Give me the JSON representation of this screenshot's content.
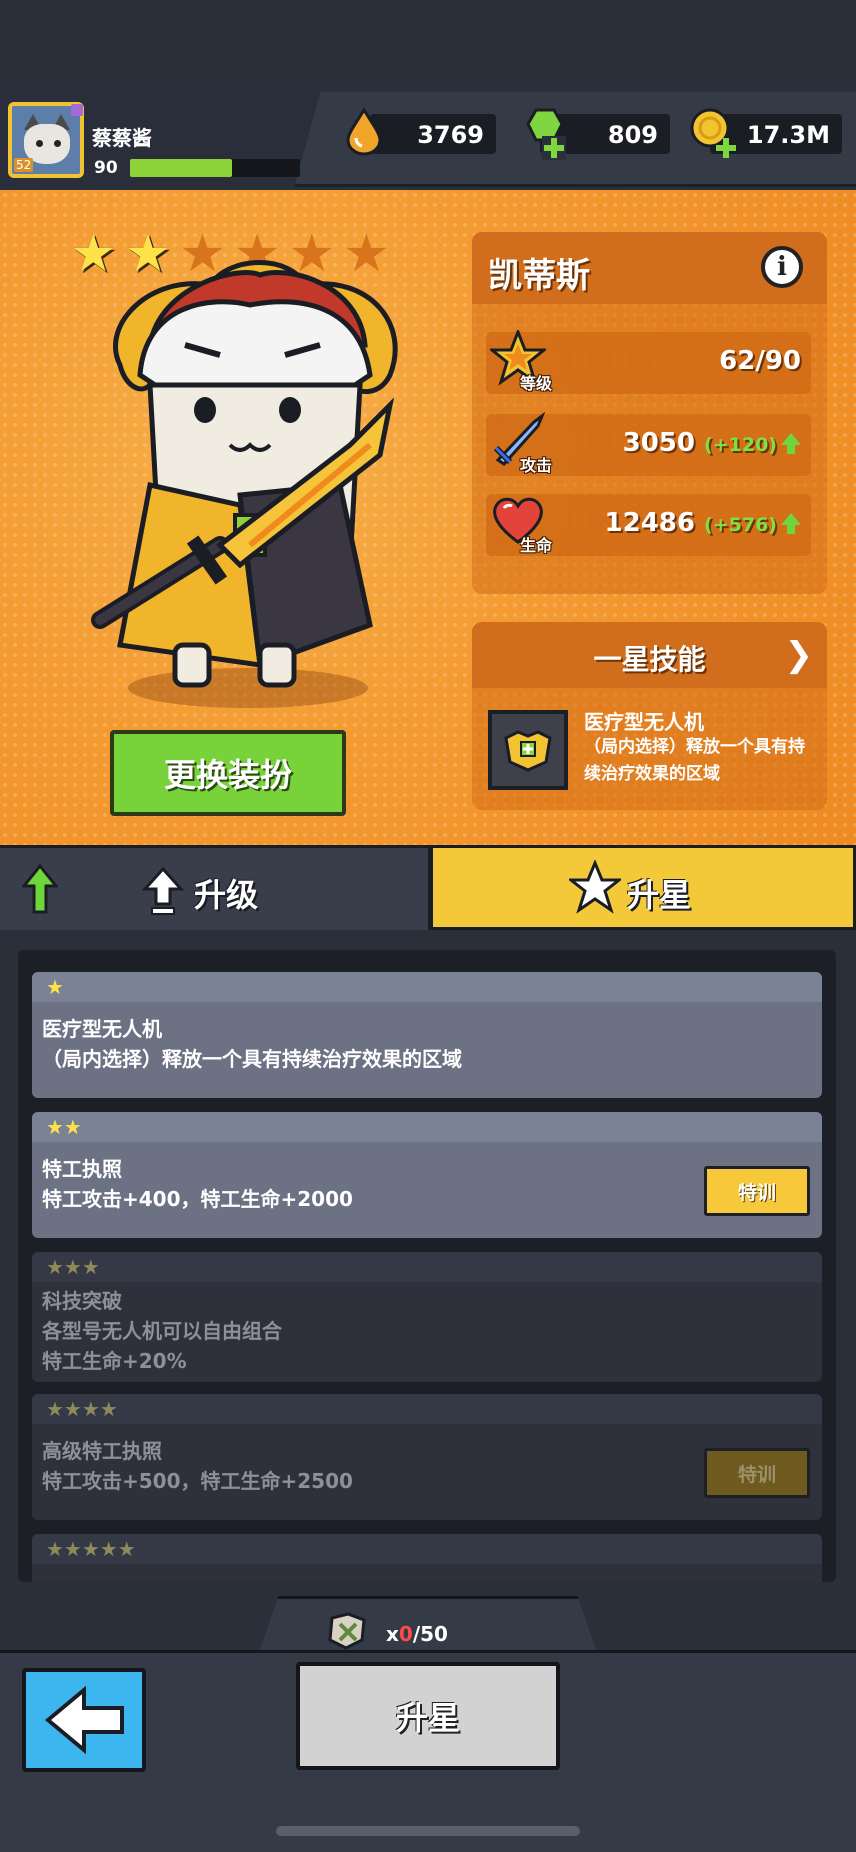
{
  "player": {
    "name": "蔡蔡酱",
    "level": "90",
    "avatar_tag": "52",
    "xp_fraction": 0.6
  },
  "currencies": [
    {
      "name": "energy",
      "icon": "drop-icon",
      "value": "3769"
    },
    {
      "name": "gems",
      "icon": "gem-plus-icon",
      "value": "809"
    },
    {
      "name": "gold",
      "icon": "coin-plus-icon",
      "value": "17.3M"
    }
  ],
  "hero": {
    "name": "凯蒂斯",
    "stars_on": 2,
    "stars_total": 6,
    "stats": [
      {
        "label": "等级",
        "value": "62/90",
        "bonus": ""
      },
      {
        "label": "攻击",
        "value": "3050",
        "bonus": "(+120)"
      },
      {
        "label": "生命",
        "value": "12486",
        "bonus": "(+576)"
      }
    ],
    "swap_button": "更换装扮"
  },
  "skill": {
    "header": "一星技能",
    "name": "医疗型无人机",
    "desc": "（局内选择）释放一个具有持续治疗效果的区域"
  },
  "tabs": {
    "upgrade": "升级",
    "starup": "升星"
  },
  "star_list": [
    {
      "stars": "★",
      "lines": [
        "医疗型无人机",
        "（局内选择）释放一个具有持续治疗效果的区域"
      ],
      "button": "",
      "active": true
    },
    {
      "stars": "★★",
      "lines": [
        "特工执照",
        "特工攻击+400，特工生命+2000"
      ],
      "button": "特训",
      "active": true
    },
    {
      "stars": "★★★",
      "lines": [
        "科技突破",
        "各型号无人机可以自由组合",
        "特工生命+20%"
      ],
      "button": "",
      "active": false
    },
    {
      "stars": "★★★★",
      "lines": [
        "高级特工执照",
        "特工攻击+500，特工生命+2500"
      ],
      "button": "特训",
      "active": false
    },
    {
      "stars": "★★★★★",
      "lines": [],
      "button": "",
      "active": false
    }
  ],
  "cost": {
    "prefix": "x",
    "have": "0",
    "need": "/50"
  },
  "bottom": {
    "starup_button": "升星"
  },
  "colors": {
    "accent_orange": "#f39a30",
    "accent_yellow": "#f3c93a",
    "green": "#78d23a"
  }
}
